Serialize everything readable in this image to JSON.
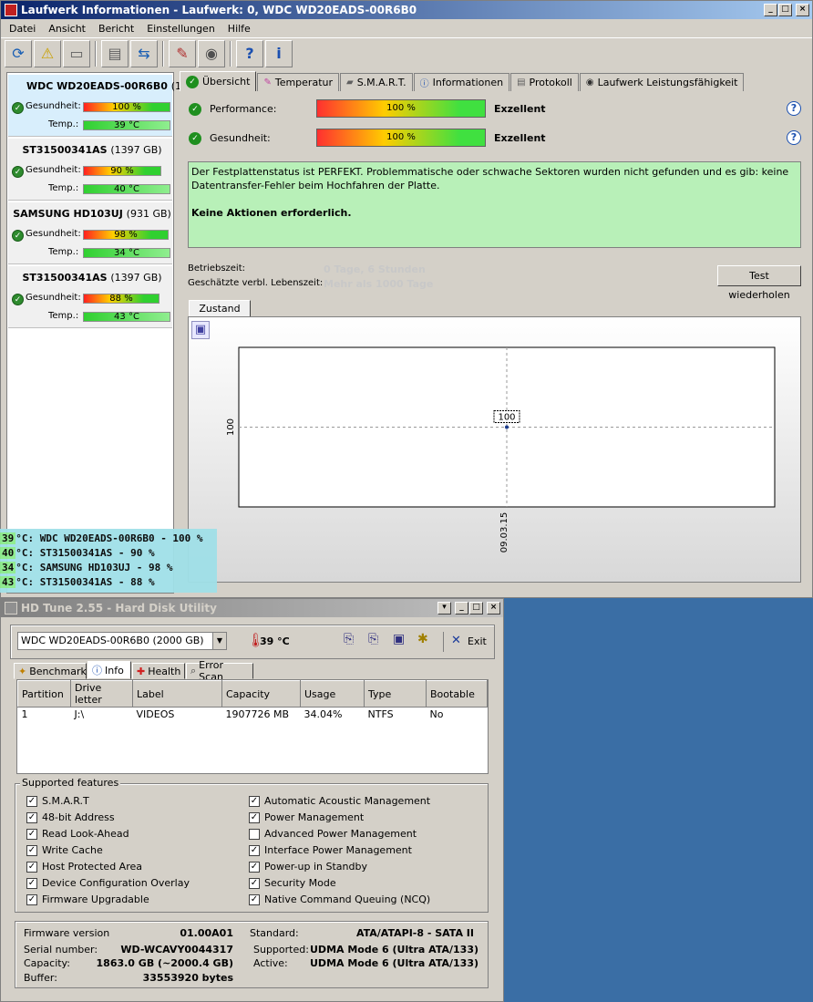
{
  "win1": {
    "title": "Laufwerk Informationen - Laufwerk: 0, WDC WD20EADS-00R6B0",
    "menu": [
      "Datei",
      "Ansicht",
      "Bericht",
      "Einstellungen",
      "Hilfe"
    ],
    "drives": [
      {
        "name": "WDC WD20EADS-00R6B0",
        "size": "(1",
        "health": "100 %",
        "health_level": 100,
        "temp": "39 °C"
      },
      {
        "name": "ST31500341AS",
        "size": "(1397 GB)",
        "health": "90 %",
        "health_level": 90,
        "temp": "40 °C"
      },
      {
        "name": "SAMSUNG HD103UJ",
        "size": "(931 GB)",
        "health": "98 %",
        "health_level": 98,
        "temp": "34 °C"
      },
      {
        "name": "ST31500341AS",
        "size": "(1397 GB)",
        "health": "88 %",
        "health_level": 88,
        "temp": "43 °C"
      }
    ],
    "labels": {
      "health": "Gesundheit:",
      "temp": "Temp.:"
    },
    "tabs": [
      "Übersicht",
      "Temperatur",
      "S.M.A.R.T.",
      "Informationen",
      "Protokoll",
      "Laufwerk Leistungsfähigkeit"
    ],
    "performance": {
      "label": "Performance:",
      "value": "100 %",
      "rating": "Exzellent"
    },
    "gesundheit": {
      "label": "Gesundheit:",
      "value": "100 %",
      "rating": "Exzellent"
    },
    "status_text": "Der Festplattenstatus ist PERFEKT. Problemmatische oder schwache Sektoren wurden nicht gefunden und es gib: keine Datentransfer-Fehler beim Hochfahren der Platte.",
    "status_action": "Keine Aktionen erforderlich.",
    "betriebszeit_label": "Betriebszeit:",
    "betriebszeit_value": "0 Tage, 6 Stunden",
    "lebenszeit_label": "Geschätzte verbl. Lebenszeit:",
    "lebenszeit_value": "Mehr als 1000 Tage",
    "retest_button": "Test wiederholen",
    "chart_tab": "Zustand (%)"
  },
  "chart_data": {
    "type": "line",
    "x": [
      "09.03.15"
    ],
    "y": [
      100
    ],
    "data_labels": [
      "100"
    ],
    "ytick": "100",
    "xtick": "09.03.15",
    "color": "#1a3a8a"
  },
  "overlay": [
    {
      "temp": "39",
      "text": " °C: WDC WD20EADS-00R6B0 - 100 %"
    },
    {
      "temp": "40",
      "text": " °C: ST31500341AS - 90 %"
    },
    {
      "temp": "34",
      "text": " °C: SAMSUNG HD103UJ - 98 %"
    },
    {
      "temp": "43",
      "text": " °C: ST31500341AS - 88 %"
    }
  ],
  "win2": {
    "title": "HD Tune 2.55 - Hard Disk Utility",
    "drive_select": "WDC WD20EADS-00R6B0 (2000 GB)",
    "temp": "39 °C",
    "exit_label": "Exit",
    "tabs": [
      "Benchmark",
      "Info",
      "Health",
      "Error Scan"
    ],
    "partition_headers": [
      "Partition",
      "Drive letter",
      "Label",
      "Capacity",
      "Usage",
      "Type",
      "Bootable"
    ],
    "partitions": [
      [
        "1",
        "J:\\",
        "VIDEOS",
        "1907726 MB",
        "34.04%",
        "NTFS",
        "No"
      ]
    ],
    "features_title": "Supported features",
    "features_left": [
      {
        "label": "S.M.A.R.T",
        "checked": "✓"
      },
      {
        "label": "48-bit Address",
        "checked": "✓"
      },
      {
        "label": "Read Look-Ahead",
        "checked": "✓"
      },
      {
        "label": "Write Cache",
        "checked": "✓"
      },
      {
        "label": "Host Protected Area",
        "checked": "✓"
      },
      {
        "label": "Device Configuration Overlay",
        "checked": "✓"
      },
      {
        "label": "Firmware Upgradable",
        "checked": "✓"
      }
    ],
    "features_right": [
      {
        "label": "Automatic Acoustic Management",
        "checked": "✓"
      },
      {
        "label": "Power Management",
        "checked": "✓"
      },
      {
        "label": "Advanced Power Management",
        "checked": ""
      },
      {
        "label": "Interface Power Management",
        "checked": "✓"
      },
      {
        "label": "Power-up in Standby",
        "checked": "✓"
      },
      {
        "label": "Security Mode",
        "checked": "✓"
      },
      {
        "label": "Native Command Queuing (NCQ)",
        "checked": "✓"
      }
    ],
    "info": {
      "firmware_label": "Firmware version",
      "firmware": "01.00A01",
      "serial_label": "Serial number:",
      "serial": "WD-WCAVY0044317",
      "capacity_label": "Capacity:",
      "capacity": "1863.0 GB (~2000.4 GB)",
      "buffer_label": "Buffer:",
      "buffer": "33553920 bytes",
      "standard_label": "Standard:",
      "standard": "ATA/ATAPI-8 - SATA II",
      "supported_label": "Supported:",
      "supported": "UDMA Mode 6 (Ultra ATA/133)",
      "active_label": "Active:",
      "active": "UDMA Mode 6 (Ultra ATA/133)"
    }
  }
}
